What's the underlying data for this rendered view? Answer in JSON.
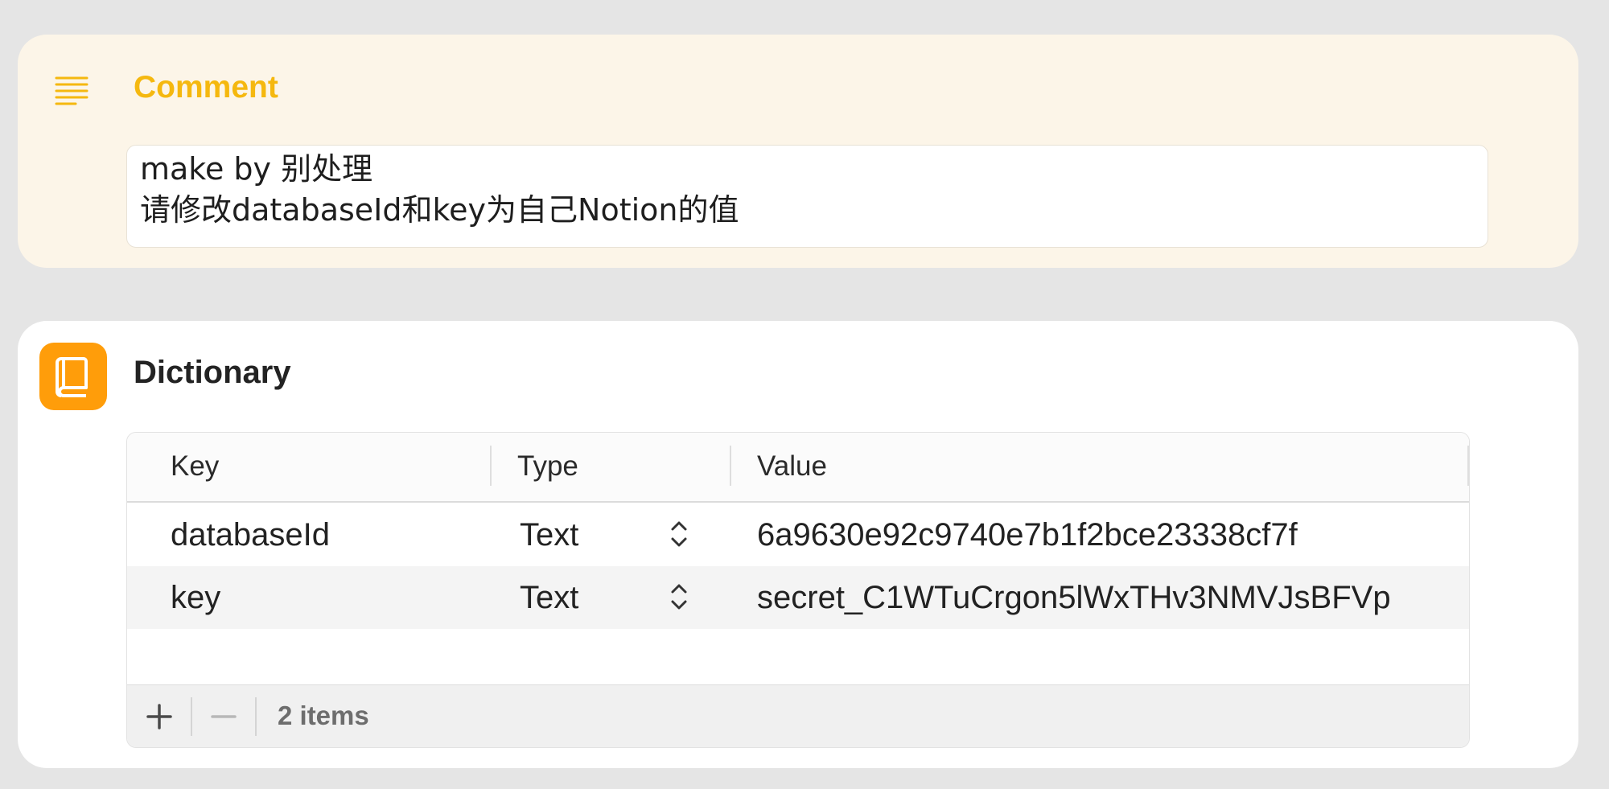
{
  "comment": {
    "title": "Comment",
    "icon": "text-align-lines-icon",
    "accent_color": "#f5b80f",
    "text": "make by 别处理\n请修改databaseId和key为自己Notion的值"
  },
  "dictionary": {
    "title": "Dictionary",
    "icon": "book-icon",
    "icon_color": "#ff9d0a",
    "columns": [
      "Key",
      "Type",
      "Value"
    ],
    "rows": [
      {
        "key": "databaseId",
        "type": "Text",
        "value": "6a9630e92c9740e7b1f2bce23338cf7f"
      },
      {
        "key": "key",
        "type": "Text",
        "value": "secret_C1WTuCrgon5lWxTHv3NMVJsBFVp"
      }
    ],
    "footer": {
      "add_icon": "plus-icon",
      "remove_icon": "minus-icon",
      "count_label": "2 items"
    }
  }
}
